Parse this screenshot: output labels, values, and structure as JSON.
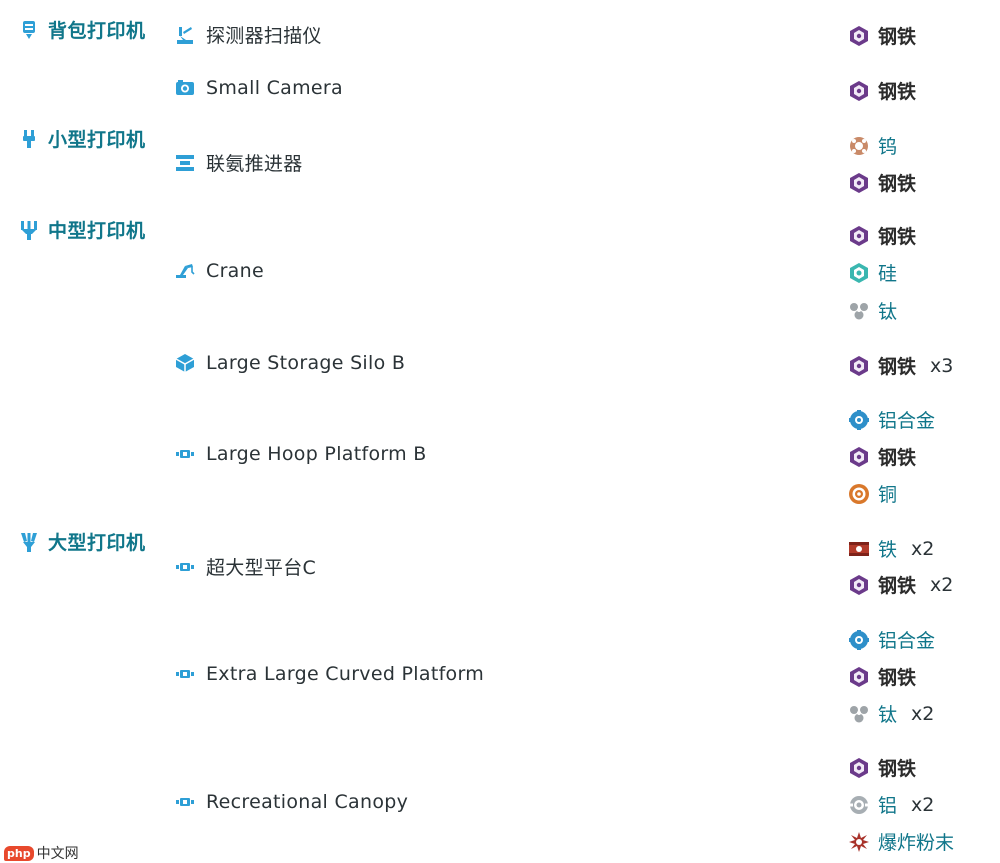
{
  "printers": {
    "backpack": "背包打印机",
    "small": "小型打印机",
    "medium": "中型打印机",
    "large": "大型打印机"
  },
  "items": {
    "probe_scanner": "探测器扫描仪",
    "small_camera": "Small Camera",
    "hydrazine_thruster": "联氨推进器",
    "crane": "Crane",
    "large_storage_silo_b": "Large Storage Silo B",
    "large_hoop_platform_b": "Large Hoop Platform B",
    "extra_large_platform_c": "超大型平台C",
    "extra_large_curved_platform": "Extra Large Curved Platform",
    "recreational_canopy": "Recreational Canopy"
  },
  "resources": {
    "steel": "钢铁",
    "tungsten": "钨",
    "silicon": "硅",
    "titanium": "钛",
    "aluminum_alloy": "铝合金",
    "copper": "铜",
    "iron": "铁",
    "aluminum": "铝",
    "explosive_powder": "爆炸粉末"
  },
  "quantities": {
    "x2": "x2",
    "x3": "x3"
  },
  "watermark": {
    "logo": "php",
    "text": "中文网"
  },
  "colors": {
    "link": "#10768a",
    "icon_blue": "#2e9fd6",
    "steel_purple": "#6b3a8a"
  }
}
